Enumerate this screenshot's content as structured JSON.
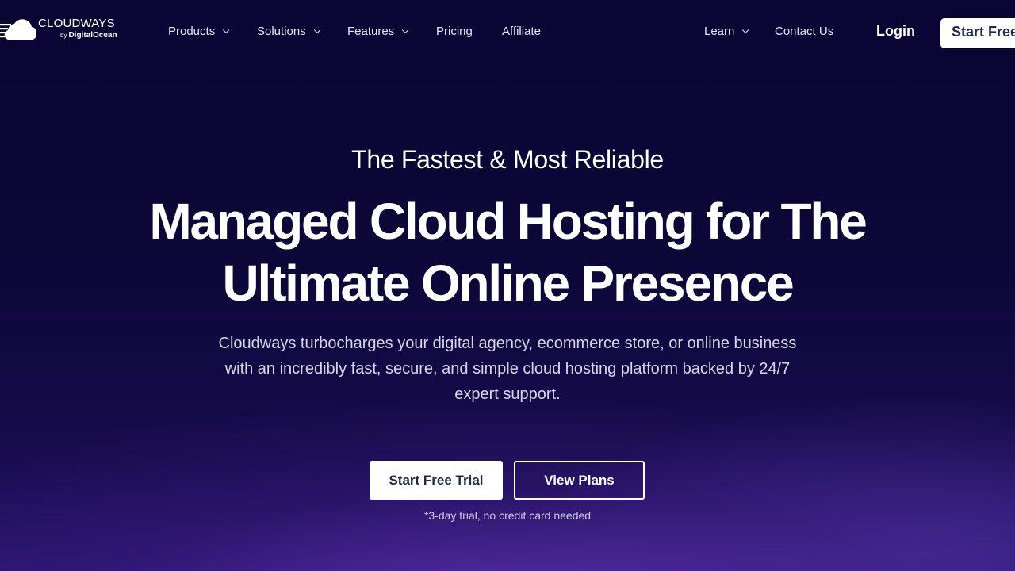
{
  "brand": {
    "name": "CLOUDWAYS",
    "by_prefix": "by",
    "by_name": "DigitalOcean",
    "logo_icon": "cloud-logo-icon"
  },
  "nav": {
    "left_items": [
      {
        "label": "Products",
        "has_dropdown": true
      },
      {
        "label": "Solutions",
        "has_dropdown": true
      },
      {
        "label": "Features",
        "has_dropdown": true
      },
      {
        "label": "Pricing",
        "has_dropdown": false
      },
      {
        "label": "Affiliate",
        "has_dropdown": false
      }
    ],
    "right_items": [
      {
        "label": "Learn",
        "has_dropdown": true
      },
      {
        "label": "Contact Us",
        "has_dropdown": false
      }
    ],
    "login_label": "Login",
    "start_label": "Start Free"
  },
  "hero": {
    "eyebrow": "The Fastest & Most Reliable",
    "headline_line1": "Managed Cloud Hosting for The",
    "headline_line2": "Ultimate Online Presence",
    "description": "Cloudways turbocharges your digital agency, ecommerce store, or online business with an incredibly fast, secure, and simple cloud hosting platform backed by 24/7 expert support.",
    "primary_cta": "Start Free Trial",
    "secondary_cta": "View Plans",
    "note": "*3-day trial, no credit card needed"
  },
  "colors": {
    "background": "#0b0634",
    "button_text": "#1d2a4a",
    "accent_glow": "#5c30aa"
  }
}
